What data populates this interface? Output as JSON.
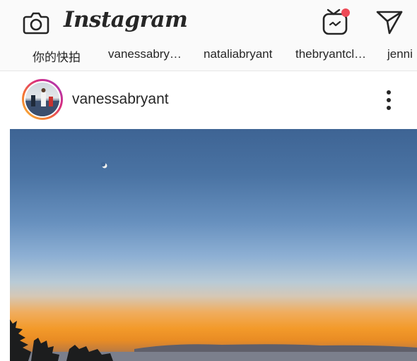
{
  "app": {
    "brand": "Instagram",
    "icons": {
      "camera": "camera-icon",
      "igtv": "igtv-icon",
      "direct": "direct-message-icon"
    },
    "notification_color": "#ed4956"
  },
  "stories": {
    "items": [
      {
        "label": "你的快拍"
      },
      {
        "label": "vanessabry…"
      },
      {
        "label": "nataliabryant"
      },
      {
        "label": "thebryantcl…"
      },
      {
        "label": "jenni"
      }
    ]
  },
  "post": {
    "username": "vanessabryant",
    "avatar_ring_colors": [
      "#f9c23a",
      "#f47133",
      "#d92e7f",
      "#9b3cc4"
    ],
    "options_icon": "more-options-icon",
    "image_alt": ""
  }
}
